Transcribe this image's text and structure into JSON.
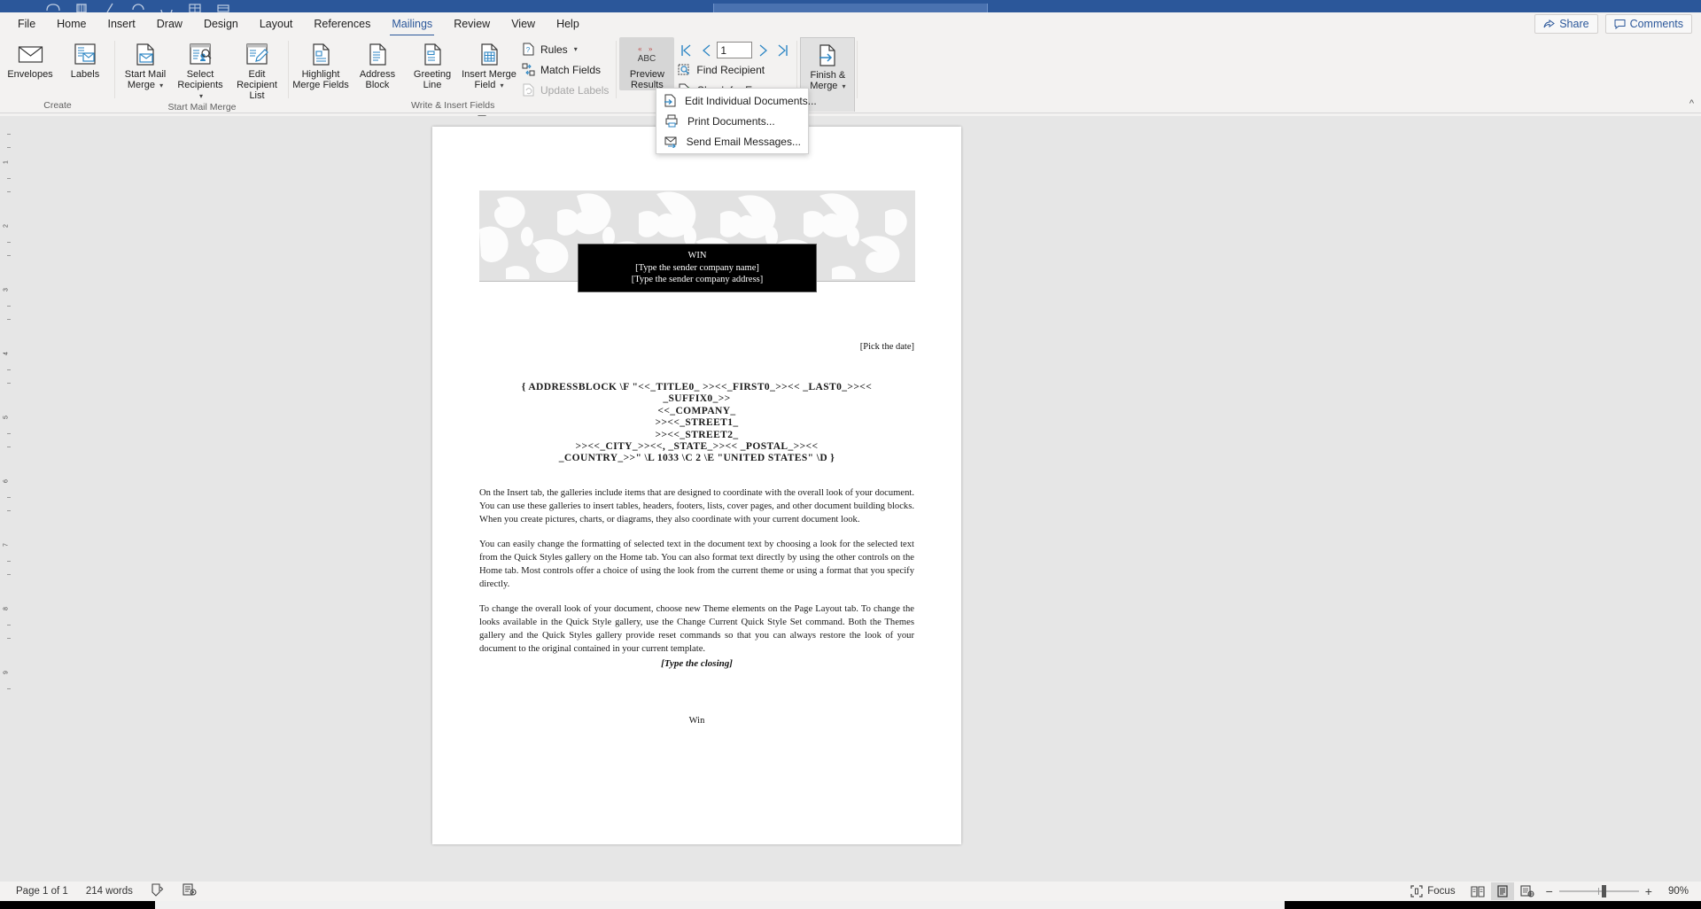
{
  "window": {
    "app": "Microsoft Word"
  },
  "tabs": [
    {
      "label": "File",
      "active": false
    },
    {
      "label": "Home",
      "active": false
    },
    {
      "label": "Insert",
      "active": false
    },
    {
      "label": "Draw",
      "active": false
    },
    {
      "label": "Design",
      "active": false
    },
    {
      "label": "Layout",
      "active": false
    },
    {
      "label": "References",
      "active": false
    },
    {
      "label": "Mailings",
      "active": true
    },
    {
      "label": "Review",
      "active": false
    },
    {
      "label": "View",
      "active": false
    },
    {
      "label": "Help",
      "active": false
    }
  ],
  "tabstrip_right": {
    "share_label": "Share",
    "comments_label": "Comments",
    "share_icon": "share-icon",
    "comments_icon": "comment-bubble-icon"
  },
  "ribbon": {
    "groups": [
      {
        "name": "create",
        "label": "Create",
        "buttons": [
          {
            "label": "Envelopes",
            "icon": "envelope-icon"
          },
          {
            "label": "Labels",
            "icon": "labels-icon"
          }
        ]
      },
      {
        "name": "start-mail-merge",
        "label": "Start Mail Merge",
        "buttons": [
          {
            "label": "Start Mail\nMerge",
            "icon": "start-mail-merge-icon",
            "dropdown": true
          },
          {
            "label": "Select\nRecipients",
            "icon": "select-recipients-icon",
            "dropdown": true
          },
          {
            "label": "Edit\nRecipient List",
            "icon": "edit-recipient-list-icon",
            "dropdown": false
          }
        ]
      },
      {
        "name": "write-insert-fields",
        "label": "Write & Insert Fields",
        "buttons": [
          {
            "label": "Highlight\nMerge Fields",
            "icon": "highlight-merge-fields-icon"
          },
          {
            "label": "Address\nBlock",
            "icon": "address-block-icon"
          },
          {
            "label": "Greeting\nLine",
            "icon": "greeting-line-icon"
          },
          {
            "label": "Insert Merge\nField",
            "icon": "insert-merge-field-icon",
            "dropdown": true
          }
        ],
        "small_buttons": [
          {
            "label": "Rules",
            "icon": "rules-icon",
            "dropdown": true,
            "disabled": false
          },
          {
            "label": "Match Fields",
            "icon": "match-fields-icon",
            "dropdown": false,
            "disabled": false
          },
          {
            "label": "Update Labels",
            "icon": "update-labels-icon",
            "dropdown": false,
            "disabled": true
          }
        ]
      },
      {
        "name": "preview-results",
        "label": "Preview Results",
        "buttons": [
          {
            "label": "Preview\nResults",
            "icon": "preview-results-abc-icon",
            "toggled": true
          }
        ],
        "record_nav": {
          "first_icon": "first-record-icon",
          "prev_icon": "previous-record-icon",
          "value": "1",
          "next_icon": "next-record-icon",
          "last_icon": "last-record-icon"
        },
        "small_buttons": [
          {
            "label": "Find Recipient",
            "icon": "find-recipient-icon"
          },
          {
            "label": "Check for Errors",
            "icon": "check-for-errors-icon"
          }
        ]
      },
      {
        "name": "finish",
        "label": "",
        "buttons": [
          {
            "label": "Finish &\nMerge",
            "icon": "finish-and-merge-icon",
            "dropdown": true,
            "pressed": true
          }
        ]
      }
    ]
  },
  "menu": {
    "name": "finish-and-merge-menu",
    "items": [
      {
        "label": "Edit Individual Documents...",
        "accel": "E",
        "icon": "edit-individual-documents-icon"
      },
      {
        "label": "Print Documents...",
        "accel": "P",
        "icon": "print-documents-icon"
      },
      {
        "label": "Send Email Messages...",
        "accel": "S",
        "icon": "send-email-messages-icon"
      }
    ]
  },
  "ruler": {
    "tab_selector": "L",
    "numbers": [
      "1",
      "2",
      "3",
      "4",
      "5",
      "6"
    ]
  },
  "document": {
    "letterhead": {
      "company_tag": "WIN",
      "sender_company_name": "[Type the sender company name]",
      "sender_company_address": "[Type the sender company address]"
    },
    "date_placeholder": "[Pick the date]",
    "address_block_field": [
      "{ ADDRESSBLOCK \\F \"<<_TITLE0_ >><<_FIRST0_>><< _LAST0_>><<",
      "_SUFFIX0_>>",
      "<<_COMPANY_",
      ">><<_STREET1_",
      ">><<_STREET2_",
      ">><<_CITY_>><<, _STATE_>><< _POSTAL_>><<",
      "_COUNTRY_>>\" \\L 1033 \\C 2 \\E \"UNITED STATES\" \\D }"
    ],
    "paragraphs": [
      "On the Insert tab, the galleries include items that are designed to coordinate with the overall look of your document. You can use these galleries to insert tables, headers, footers, lists, cover pages, and other document building blocks. When you create pictures, charts, or diagrams, they also coordinate with your current document look.",
      "You can easily change the formatting of selected text in the document text by choosing a look for the selected text from the Quick Styles gallery on the Home tab. You can also format text directly by using the other controls on the Home tab. Most controls offer a choice of using the look from the current theme or using a format that you specify directly.",
      "To change the overall look of your document, choose new Theme elements on the Page Layout tab. To change the looks available in the Quick Style gallery, use the Change Current Quick Style Set command. Both the Themes gallery and the Quick Styles gallery provide reset commands so that you can always restore the look of your document to the original contained in your current template."
    ],
    "closing_placeholder": "[Type the closing]",
    "signature": "Win"
  },
  "statusbar": {
    "page": "Page 1 of 1",
    "words": "214 words",
    "proofing_icon": "proofing-errors-icon",
    "accessibility_icon": "accessibility-checker-icon",
    "focus_label": "Focus",
    "focus_icon": "focus-mode-icon",
    "read_mode_icon": "read-mode-icon",
    "print_layout_icon": "print-layout-icon",
    "web_layout_icon": "web-layout-icon",
    "zoom_out_label": "−",
    "zoom_in_label": "+",
    "zoom_level": "90%"
  },
  "colors": {
    "accent": "#2b579a",
    "ribbon_bg": "#f3f2f1",
    "workspace_bg": "#e6e6e6"
  }
}
